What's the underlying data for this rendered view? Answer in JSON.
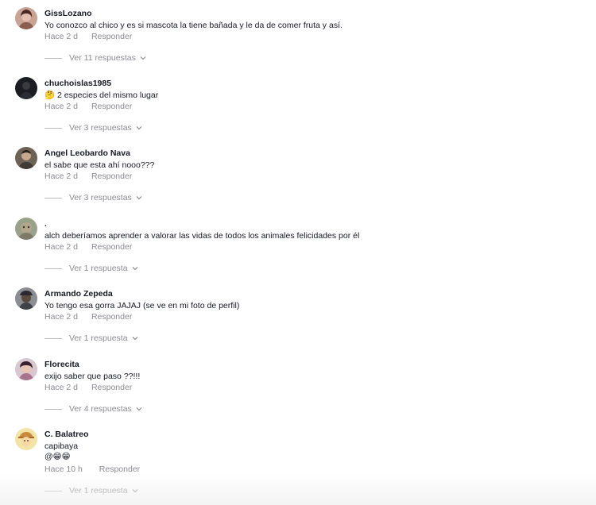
{
  "comments": [
    {
      "user": "GissLozano",
      "text": "Yo conozco al chico y es si mascota la tiene bañada y le da de comer fruta y así.",
      "time": "Hace 2 d",
      "reply": "Responder",
      "replies": "Ver 11 respuestas"
    },
    {
      "user": "chuchoislas1985",
      "text": "🤔 2 especies del mismo lugar",
      "time": "Hace 2 d",
      "reply": "Responder",
      "replies": "Ver 3 respuestas"
    },
    {
      "user": "Angel Leobardo Nava",
      "text": "el sabe que esta ahí nooo???",
      "time": "Hace 2 d",
      "reply": "Responder",
      "replies": "Ver 3 respuestas"
    },
    {
      "user": ".",
      "text": "alch deberíamos aprender a valorar las vidas de todos los animales felicidades por él",
      "time": "Hace 2 d",
      "reply": "Responder",
      "replies": "Ver 1 respuesta"
    },
    {
      "user": "Armando Zepeda",
      "text": "Yo tengo esa gorra JAJAJ (se ve en mi foto de perfil)",
      "time": "Hace 2 d",
      "reply": "Responder",
      "replies": "Ver 1 respuesta"
    },
    {
      "user": "Florecita",
      "text": "exijo saber que paso ??!!!",
      "time": "Hace 2 d",
      "reply": "Responder",
      "replies": "Ver 4 respuestas"
    },
    {
      "user": "C. Balatreo",
      "text": "capibaya",
      "text2": "@😁😁",
      "time": "Hace 10 h",
      "reply": "Responder",
      "replies": "Ver 1 respuesta"
    }
  ],
  "icons": {
    "avatar": "user-avatar",
    "chevron": "chevron-down-icon"
  }
}
